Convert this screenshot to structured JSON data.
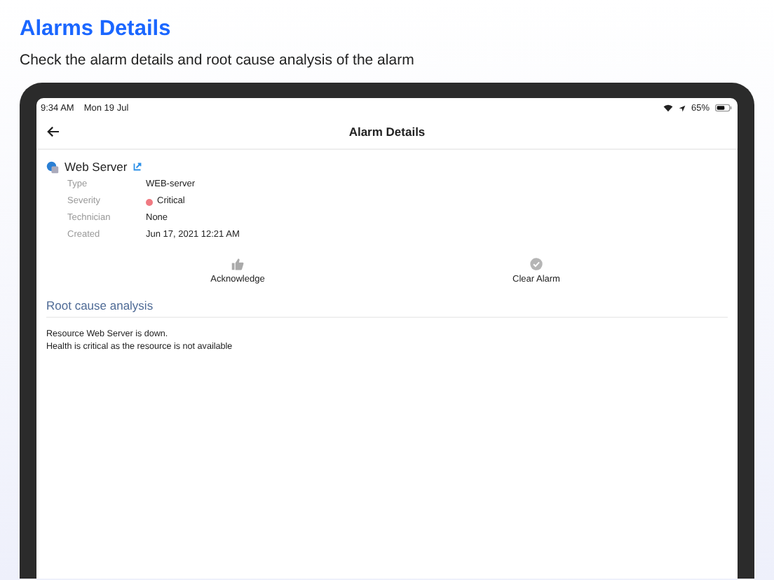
{
  "page": {
    "title": "Alarms Details",
    "subtitle": "Check the alarm details and root cause analysis of the alarm"
  },
  "status_bar": {
    "time": "9:34 AM",
    "date": "Mon 19 Jul",
    "battery": "65%"
  },
  "nav_bar": {
    "title": "Alarm Details"
  },
  "resource": {
    "name": "Web Server"
  },
  "details": [
    {
      "label": "Type",
      "value": "WEB-server"
    },
    {
      "label": "Severity",
      "value": "Critical",
      "color": "#f07a82"
    },
    {
      "label": "Technician",
      "value": "None"
    },
    {
      "label": "Created",
      "value": "Jun 17, 2021 12:21 AM"
    }
  ],
  "actions": [
    {
      "kind": "acknowledge",
      "label": "Acknowledge"
    },
    {
      "kind": "clear",
      "label": "Clear Alarm"
    }
  ],
  "root_cause": {
    "heading": "Root cause analysis",
    "lines": [
      "Resource Web Server is down.",
      "Health is critical as the resource is not available"
    ]
  }
}
